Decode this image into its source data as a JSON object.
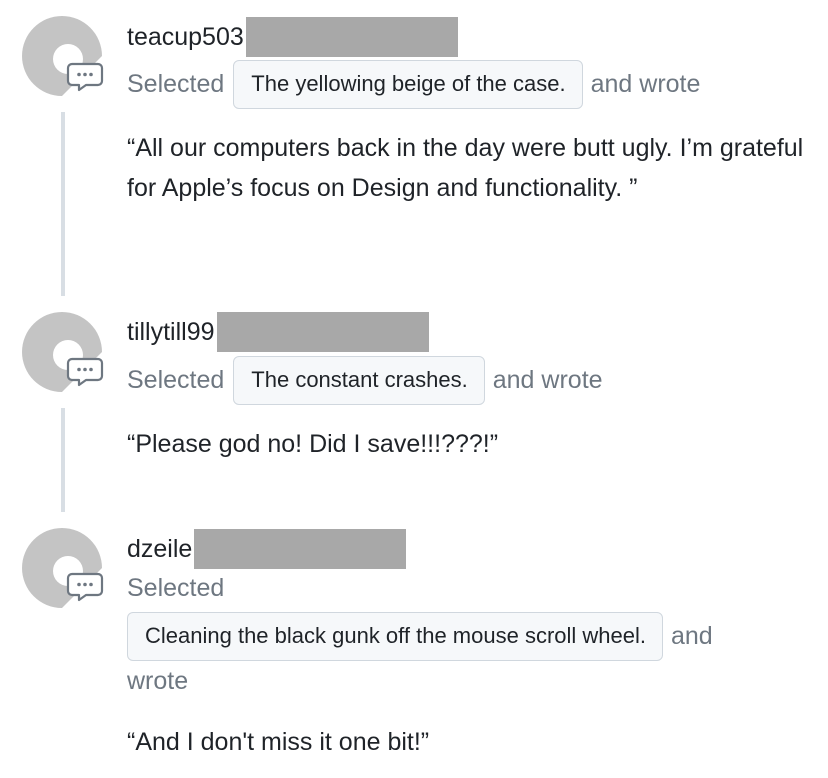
{
  "comments": [
    {
      "username": "teacup503",
      "selected_label": "Selected",
      "selection": "The yellowing beige of the case.",
      "and_wrote": "and wrote",
      "comment": "“All our computers back in the day were butt ugly. I’m grateful for Apple’s focus on Design and functionality. ”"
    },
    {
      "username": "tillytill99",
      "selected_label": "Selected",
      "selection": "The constant crashes.",
      "and_wrote": "and wrote",
      "comment": "“Please god no! Did I save!!!???!”"
    },
    {
      "username": "dzeile",
      "selected_label": "Selected",
      "selection": "Cleaning the black gunk off the mouse scroll wheel.",
      "and_label": "and",
      "wrote_label": "wrote",
      "comment": "“And I don't miss it one bit!”"
    }
  ],
  "colors": {
    "avatar": "#c4c4c4",
    "redaction": "#a8a8a8",
    "chip_bg": "#f6f8fa",
    "chip_border": "#d0d7de",
    "muted_text": "#6e7781",
    "timeline": "#d8dee4"
  },
  "icons": [
    "default-avatar-icon",
    "comment-bubble-icon"
  ]
}
